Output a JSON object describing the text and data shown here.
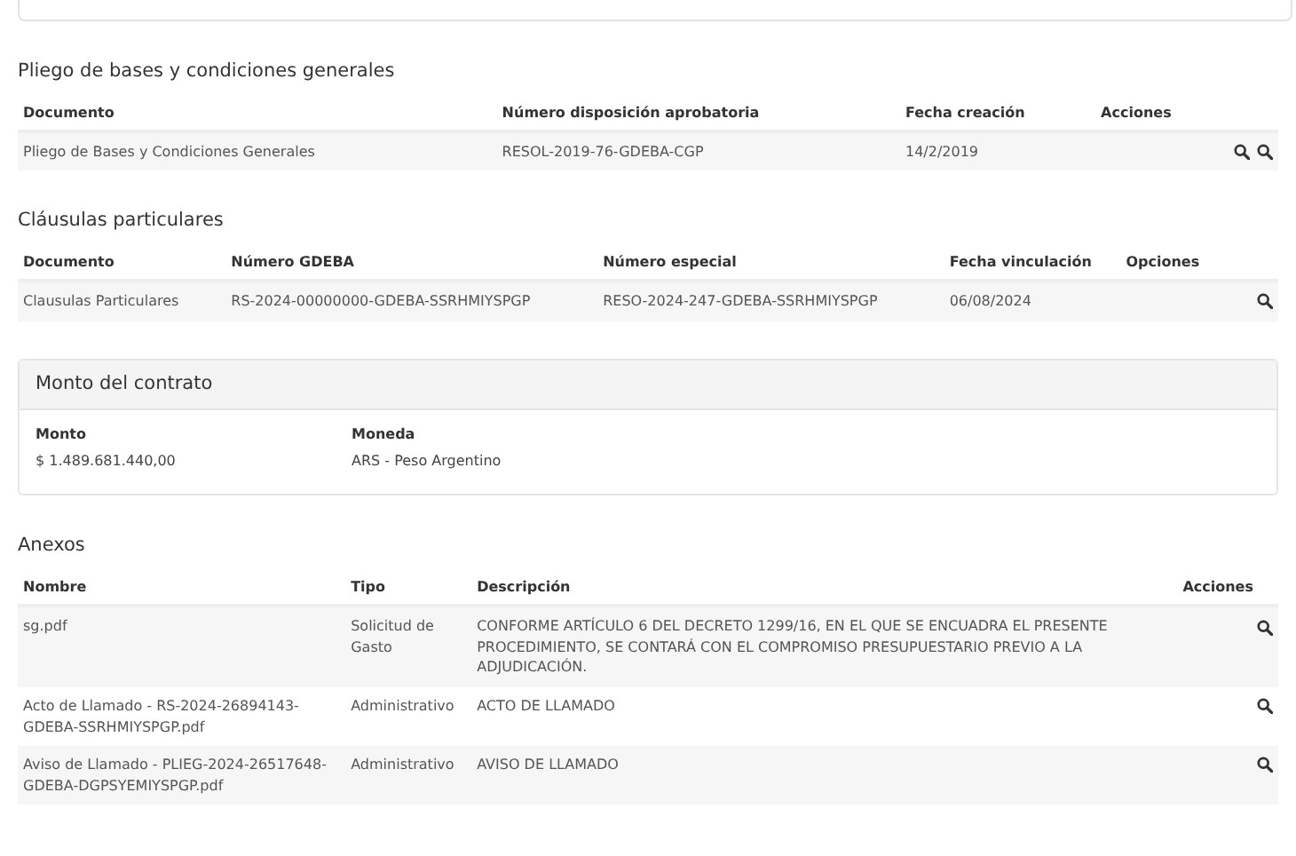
{
  "sections": [
    {
      "kind": "table",
      "title": "Pliego de bases y condiciones generales",
      "columns": [
        "Documento",
        "Número disposición aprobatoria",
        "Fecha creación",
        "Acciones"
      ],
      "rows": [
        {
          "cells": [
            "Pliego de Bases y Condiciones Generales",
            "RESOL-2019-76-GDEBA-CGP",
            "14/2/2019"
          ],
          "actions": [
            {
              "kind": "search"
            },
            {
              "kind": "search"
            }
          ]
        }
      ]
    },
    {
      "kind": "table",
      "title": "Cláusulas particulares",
      "columns": [
        "Documento",
        "Número GDEBA",
        "Número especial",
        "Fecha vinculación",
        "Opciones"
      ],
      "rows": [
        {
          "cells": [
            "Clausulas Particulares",
            "RS-2024-00000000-GDEBA-SSRHMIYSPGP",
            "RESO-2024-247-GDEBA-SSRHMIYSPGP",
            "06/08/2024"
          ],
          "actions": [
            {
              "kind": "search"
            }
          ]
        }
      ]
    },
    {
      "kind": "card",
      "title": "Monto del contrato",
      "fields": [
        {
          "label": "Monto",
          "value": "$ 1.489.681.440,00"
        },
        {
          "label": "Moneda",
          "value": "ARS - Peso Argentino"
        }
      ]
    },
    {
      "kind": "table",
      "title": "Anexos",
      "columns": [
        "Nombre",
        "Tipo",
        "Descripción",
        "Acciones"
      ],
      "rows": [
        {
          "cells": [
            "sg.pdf",
            "Solicitud de Gasto",
            "CONFORME ARTÍCULO 6 DEL DECRETO 1299/16, EN EL QUE SE ENCUADRA EL PRESENTE PROCEDIMIENTO, SE CONTARÁ CON EL COMPROMISO PRESUPUESTARIO PREVIO A LA ADJUDICACIÓN."
          ],
          "actions": [
            {
              "kind": "search"
            }
          ]
        },
        {
          "cells": [
            "Acto de Llamado - RS-2024-26894143-GDEBA-SSRHMIYSPGP.pdf",
            "Administrativo",
            "ACTO DE LLAMADO"
          ],
          "actions": [
            {
              "kind": "search"
            }
          ]
        },
        {
          "cells": [
            "Aviso de Llamado - PLIEG-2024-26517648-GDEBA-DGPSYEMIYSPGP.pdf",
            "Administrativo",
            "AVISO DE LLAMADO"
          ],
          "actions": [
            {
              "kind": "search"
            }
          ]
        }
      ]
    }
  ]
}
